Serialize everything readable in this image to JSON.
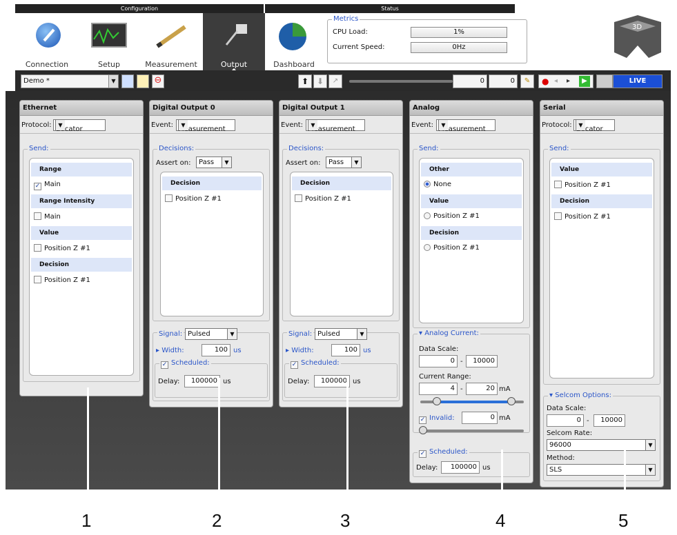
{
  "header": {
    "config_label": "Configuration",
    "status_label": "Status",
    "nav": [
      {
        "label": "Connection",
        "icon": "connection-icon"
      },
      {
        "label": "Setup",
        "icon": "setup-icon"
      },
      {
        "label": "Measurement",
        "icon": "measurement-icon"
      },
      {
        "label": "Output",
        "icon": "output-icon"
      },
      {
        "label": "Dashboard",
        "icon": "dashboard-icon"
      }
    ],
    "metrics": {
      "title": "Metrics",
      "cpu_label": "CPU Load:",
      "cpu_value": "1%",
      "speed_label": "Current Speed:",
      "speed_value": "0Hz"
    },
    "logo": "3D-LMI-logo"
  },
  "toolbar": {
    "job_value": "Demo *",
    "counter_value": "0",
    "counter_total": "0",
    "live_label": "LIVE"
  },
  "panels": {
    "ethernet": {
      "title": "Ethernet",
      "protocol_label": "Protocol:",
      "protocol_value": "Gocator",
      "send_legend": "Send:",
      "h1": "Range",
      "i1": "Main",
      "h2": "Range Intensity",
      "i2": "Main",
      "h3": "Value",
      "i3": "Position Z #1",
      "h4": "Decision",
      "i4": "Position Z #1"
    },
    "do0": {
      "title": "Digital Output 0",
      "event_label": "Event:",
      "event_value": "Measurement",
      "decisions_legend": "Decisions:",
      "assert_label": "Assert on:",
      "assert_value": "Pass",
      "list_header": "Decision",
      "item": "Position Z #1",
      "signal_legend": "Signal:",
      "signal_value": "Pulsed",
      "width_label": "Width:",
      "width_value": "100",
      "width_unit": "us",
      "scheduled_label": "Scheduled:",
      "delay_label": "Delay:",
      "delay_value": "100000",
      "delay_unit": "us"
    },
    "do1": {
      "title": "Digital Output 1",
      "event_label": "Event:",
      "event_value": "Measurement",
      "decisions_legend": "Decisions:",
      "assert_label": "Assert on:",
      "assert_value": "Pass",
      "list_header": "Decision",
      "item": "Position Z #1",
      "signal_legend": "Signal:",
      "signal_value": "Pulsed",
      "width_label": "Width:",
      "width_value": "100",
      "width_unit": "us",
      "scheduled_label": "Scheduled:",
      "delay_label": "Delay:",
      "delay_value": "100000",
      "delay_unit": "us"
    },
    "analog": {
      "title": "Analog",
      "event_label": "Event:",
      "event_value": "Measurement",
      "send_legend": "Send:",
      "h1": "Other",
      "i1": "None",
      "h2": "Value",
      "i2": "Position Z #1",
      "h3": "Decision",
      "i3": "Position Z #1",
      "current_legend": "Analog Current:",
      "data_scale_label": "Data Scale:",
      "ds_min": "0",
      "ds_sep": "-",
      "ds_max": "10000",
      "range_label": "Current Range:",
      "cr_min": "4",
      "cr_sep": "-",
      "cr_max": "20",
      "cr_unit": "mA",
      "invalid_label": "Invalid:",
      "invalid_value": "0",
      "invalid_unit": "mA",
      "scheduled_label": "Scheduled:",
      "delay_label": "Delay:",
      "delay_value": "100000",
      "delay_unit": "us"
    },
    "serial": {
      "title": "Serial",
      "protocol_label": "Protocol:",
      "protocol_value": "Gocator",
      "send_legend": "Send:",
      "h1": "Value",
      "i1": "Position Z #1",
      "h2": "Decision",
      "i2": "Position Z #1",
      "selcom_legend": "Selcom Options:",
      "data_scale_label": "Data Scale:",
      "ds_min": "0",
      "ds_sep": "-",
      "ds_max": "10000",
      "rate_label": "Selcom Rate:",
      "rate_value": "96000",
      "method_label": "Method:",
      "method_value": "SLS"
    }
  },
  "callouts": [
    "1",
    "2",
    "3",
    "4",
    "5"
  ]
}
